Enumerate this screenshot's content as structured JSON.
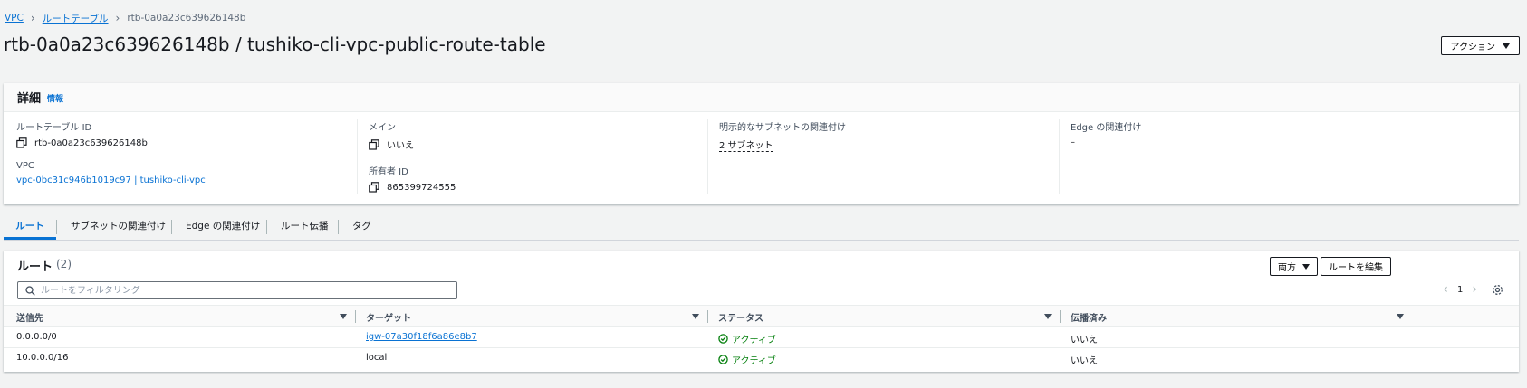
{
  "breadcrumb": {
    "items": [
      "VPC",
      "ルートテーブル"
    ],
    "current": "rtb-0a0a23c639626148b"
  },
  "header": {
    "title": "rtb-0a0a23c639626148b / tushiko-cli-vpc-public-route-table",
    "actions_label": "アクション"
  },
  "details": {
    "title": "詳細",
    "info_label": "情報",
    "route_table_id_label": "ルートテーブル ID",
    "route_table_id": "rtb-0a0a23c639626148b",
    "vpc_label": "VPC",
    "vpc_value": "vpc-0bc31c946b1019c97 | tushiko-cli-vpc",
    "main_label": "メイン",
    "main_value": "いいえ",
    "owner_label": "所有者 ID",
    "owner_value": "865399724555",
    "subnet_assoc_label": "明示的なサブネットの関連付け",
    "subnet_assoc_value": "2 サブネット",
    "edge_assoc_label": "Edge の関連付け",
    "edge_assoc_value": "–"
  },
  "tabs": [
    "ルート",
    "サブネットの関連付け",
    "Edge の関連付け",
    "ルート伝播",
    "タグ"
  ],
  "routes": {
    "title": "ルート",
    "count": "(2)",
    "both_label": "両方",
    "edit_label": "ルートを編集",
    "search_placeholder": "ルートをフィルタリング",
    "page": "1",
    "columns": [
      "送信先",
      "ターゲット",
      "ステータス",
      "伝播済み"
    ],
    "rows": [
      {
        "destination": "0.0.0.0/0",
        "target": "igw-07a30f18f6a86e8b7",
        "status": "アクティブ",
        "propagated": "いいえ"
      },
      {
        "destination": "10.0.0.0/16",
        "target": "local",
        "status": "アクティブ",
        "propagated": "いいえ"
      }
    ]
  },
  "colors": {
    "link": "#0972d3",
    "success": "#037f0c",
    "text": "#16191f"
  }
}
